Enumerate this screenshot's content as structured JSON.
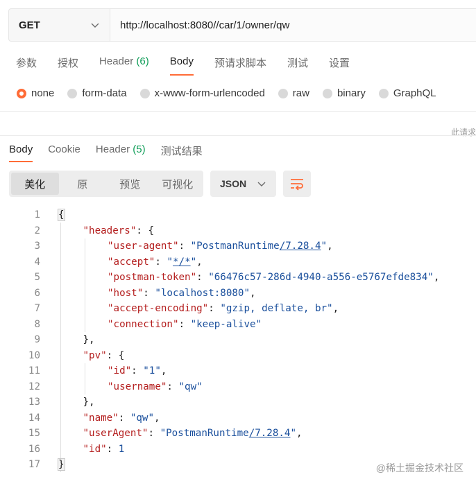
{
  "request": {
    "method": "GET",
    "url": "http://localhost:8080//car/1/owner/qw"
  },
  "request_tabs": [
    {
      "label": "参数",
      "count": ""
    },
    {
      "label": "授权",
      "count": ""
    },
    {
      "label": "Header",
      "count": "(6)"
    },
    {
      "label": "Body",
      "count": "",
      "active": true
    },
    {
      "label": "预请求脚本",
      "count": ""
    },
    {
      "label": "测试",
      "count": ""
    },
    {
      "label": "设置",
      "count": ""
    }
  ],
  "body_types": [
    {
      "label": "none",
      "selected": true
    },
    {
      "label": "form-data"
    },
    {
      "label": "x-www-form-urlencoded"
    },
    {
      "label": "raw"
    },
    {
      "label": "binary"
    },
    {
      "label": "GraphQL"
    }
  ],
  "cut_text": "此请求",
  "response_tabs": [
    {
      "label": "Body",
      "count": "",
      "active": true
    },
    {
      "label": "Cookie",
      "count": ""
    },
    {
      "label": "Header",
      "count": "(5)"
    },
    {
      "label": "测试结果",
      "count": ""
    }
  ],
  "view_modes": [
    {
      "label": "美化",
      "active": true
    },
    {
      "label": "原"
    },
    {
      "label": "预览"
    },
    {
      "label": "可视化"
    }
  ],
  "format": "JSON",
  "code_lines": [
    {
      "n": "1",
      "indent": 0,
      "parts": [
        [
          "p",
          "{"
        ]
      ]
    },
    {
      "n": "2",
      "indent": 1,
      "parts": [
        [
          "k",
          "\"headers\""
        ],
        [
          "p",
          ": {"
        ]
      ]
    },
    {
      "n": "3",
      "indent": 2,
      "parts": [
        [
          "k",
          "\"user-agent\""
        ],
        [
          "p",
          ": "
        ],
        [
          "s",
          "\"PostmanRuntime"
        ],
        [
          "su",
          "/7.28.4"
        ],
        [
          "s",
          "\""
        ],
        [
          "p",
          ","
        ]
      ]
    },
    {
      "n": "4",
      "indent": 2,
      "parts": [
        [
          "k",
          "\"accept\""
        ],
        [
          "p",
          ": "
        ],
        [
          "s",
          "\""
        ],
        [
          "su",
          "*/*"
        ],
        [
          "s",
          "\""
        ],
        [
          "p",
          ","
        ]
      ]
    },
    {
      "n": "5",
      "indent": 2,
      "parts": [
        [
          "k",
          "\"postman-token\""
        ],
        [
          "p",
          ": "
        ],
        [
          "s",
          "\"66476c57-286d-4940-a556-e5767efde834\""
        ],
        [
          "p",
          ","
        ]
      ]
    },
    {
      "n": "6",
      "indent": 2,
      "parts": [
        [
          "k",
          "\"host\""
        ],
        [
          "p",
          ": "
        ],
        [
          "s",
          "\"localhost:8080\""
        ],
        [
          "p",
          ","
        ]
      ]
    },
    {
      "n": "7",
      "indent": 2,
      "parts": [
        [
          "k",
          "\"accept-encoding\""
        ],
        [
          "p",
          ": "
        ],
        [
          "s",
          "\"gzip, deflate, br\""
        ],
        [
          "p",
          ","
        ]
      ]
    },
    {
      "n": "8",
      "indent": 2,
      "parts": [
        [
          "k",
          "\"connection\""
        ],
        [
          "p",
          ": "
        ],
        [
          "s",
          "\"keep-alive\""
        ]
      ]
    },
    {
      "n": "9",
      "indent": 1,
      "parts": [
        [
          "p",
          "},"
        ]
      ]
    },
    {
      "n": "10",
      "indent": 1,
      "parts": [
        [
          "k",
          "\"pv\""
        ],
        [
          "p",
          ": {"
        ]
      ]
    },
    {
      "n": "11",
      "indent": 2,
      "parts": [
        [
          "k",
          "\"id\""
        ],
        [
          "p",
          ": "
        ],
        [
          "s",
          "\"1\""
        ],
        [
          "p",
          ","
        ]
      ]
    },
    {
      "n": "12",
      "indent": 2,
      "parts": [
        [
          "k",
          "\"username\""
        ],
        [
          "p",
          ": "
        ],
        [
          "s",
          "\"qw\""
        ]
      ]
    },
    {
      "n": "13",
      "indent": 1,
      "parts": [
        [
          "p",
          "},"
        ]
      ]
    },
    {
      "n": "14",
      "indent": 1,
      "parts": [
        [
          "k",
          "\"name\""
        ],
        [
          "p",
          ": "
        ],
        [
          "s",
          "\"qw\""
        ],
        [
          "p",
          ","
        ]
      ]
    },
    {
      "n": "15",
      "indent": 1,
      "parts": [
        [
          "k",
          "\"userAgent\""
        ],
        [
          "p",
          ": "
        ],
        [
          "s",
          "\"PostmanRuntime"
        ],
        [
          "su",
          "/7.28.4"
        ],
        [
          "s",
          "\""
        ],
        [
          "p",
          ","
        ]
      ]
    },
    {
      "n": "16",
      "indent": 1,
      "parts": [
        [
          "k",
          "\"id\""
        ],
        [
          "p",
          ": "
        ],
        [
          "n",
          "1"
        ]
      ]
    },
    {
      "n": "17",
      "indent": 0,
      "parts": [
        [
          "p",
          "}"
        ]
      ]
    }
  ],
  "watermark": "@稀土掘金技术社区",
  "colors": {
    "accent": "#ff6c37",
    "count_green": "#0f9d58",
    "json_key": "#b41e1e",
    "json_string": "#1a4f9c"
  }
}
